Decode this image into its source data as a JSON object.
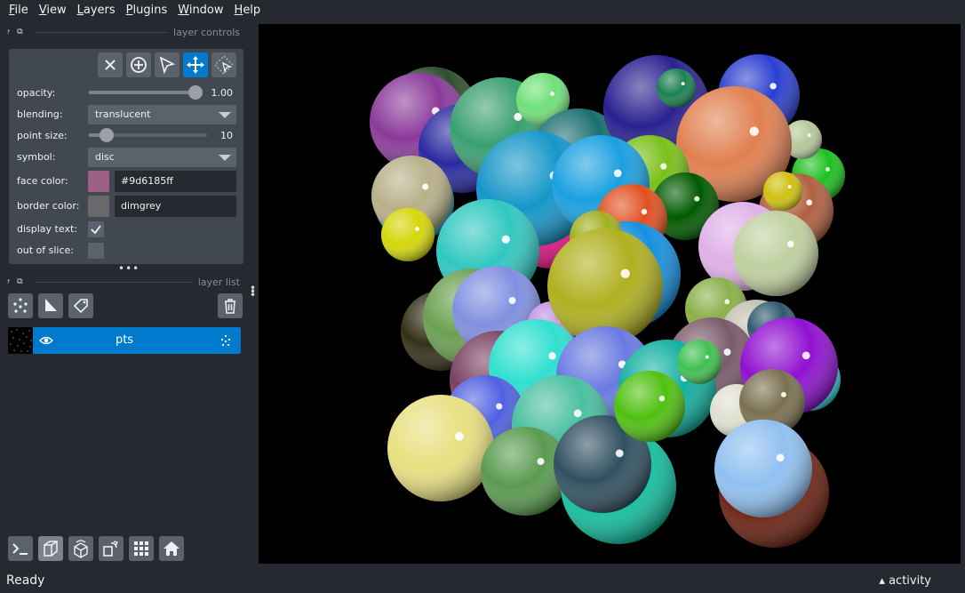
{
  "menu": [
    "File",
    "View",
    "Layers",
    "Plugins",
    "Window",
    "Help"
  ],
  "layer_controls": {
    "title": "layer controls",
    "opacity": {
      "label": "opacity:",
      "value": "1.00",
      "fraction": 1.0
    },
    "blending": {
      "label": "blending:",
      "value": "translucent"
    },
    "point_size": {
      "label": "point size:",
      "value": "10",
      "fraction": 0.1
    },
    "symbol": {
      "label": "symbol:",
      "value": "disc"
    },
    "face_color": {
      "label": "face color:",
      "value": "#9d6185ff",
      "swatch": "#9d6185"
    },
    "border_color": {
      "label": "border color:",
      "value": "dimgrey",
      "swatch": "#696969"
    },
    "display_text": {
      "label": "display text:",
      "checked": true
    },
    "out_of_slice": {
      "label": "out of slice:",
      "checked": false
    }
  },
  "layer_list": {
    "title": "layer list",
    "layers": [
      {
        "name": "pts",
        "visible": true,
        "selected": true
      }
    ]
  },
  "status": {
    "text": "Ready",
    "activity": "activity"
  },
  "colors": {
    "accent": "#007acc",
    "panel": "#414851",
    "background": "#262930",
    "button": "#5a626c"
  },
  "icons": [
    "close-icon",
    "add-point-icon",
    "select-icon",
    "pan-zoom-icon",
    "transform-icon",
    "new-points-icon",
    "new-shapes-icon",
    "new-labels-icon",
    "delete-icon",
    "eye-icon",
    "points-type-icon",
    "console-icon",
    "ndisplay-icon",
    "roll-icon",
    "transpose-icon",
    "grid-icon",
    "home-icon"
  ]
}
